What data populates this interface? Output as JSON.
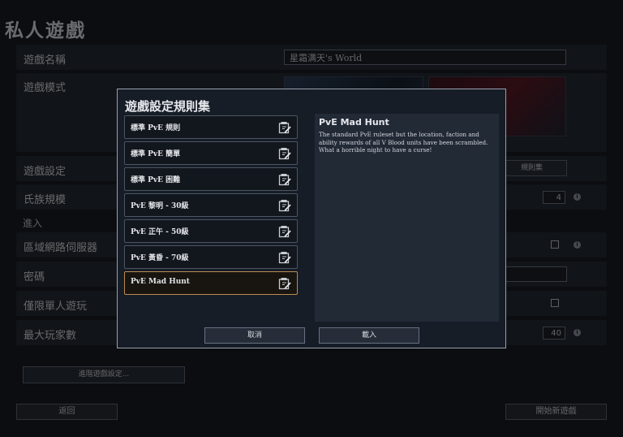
{
  "page_title": "私人遊戲",
  "settings": {
    "game_name_label": "遊戲名稱",
    "game_name_value": "星霜满天's World",
    "game_mode_label": "遊戲模式",
    "game_settings_label": "遊戲設定",
    "ruleset_button_partial": "規則集",
    "clan_size_label": "氏族規模",
    "clan_size_value": "4",
    "join_section_label": "進入",
    "lan_server_label": "區域網路伺服器",
    "password_label": "密碼",
    "single_player_label": "僅限單人遊玩",
    "max_players_label": "最大玩家數",
    "max_players_value": "40",
    "advanced_settings_button": "進階遊戲設定..."
  },
  "footer": {
    "back_button": "返回",
    "start_button": "開始新遊戲"
  },
  "modal": {
    "title": "遊戲設定規則集",
    "rulesets": [
      {
        "label": "標準 PvE 規則"
      },
      {
        "label": "標準 PvE 簡單"
      },
      {
        "label": "標準 PvE 困難"
      },
      {
        "label": "PvE 黎明 - 30級"
      },
      {
        "label": "PvE 正午 - 50級"
      },
      {
        "label": "PvE 黃昏 - 70級"
      },
      {
        "label": "PvE Mad Hunt"
      }
    ],
    "selected_index": 6,
    "description_title": "PvE Mad Hunt",
    "description_text": "The standard PvE ruleset but the location, faction and ability rewards of all V Blood units have been scrambled. What a horrible night to have a curse!",
    "cancel_button": "取消",
    "load_button": "載入"
  },
  "colors": {
    "selected_border": "#b98c52",
    "modal_border": "#98a0ad"
  },
  "icons": [
    "edit-icon",
    "info-icon",
    "checkbox"
  ]
}
